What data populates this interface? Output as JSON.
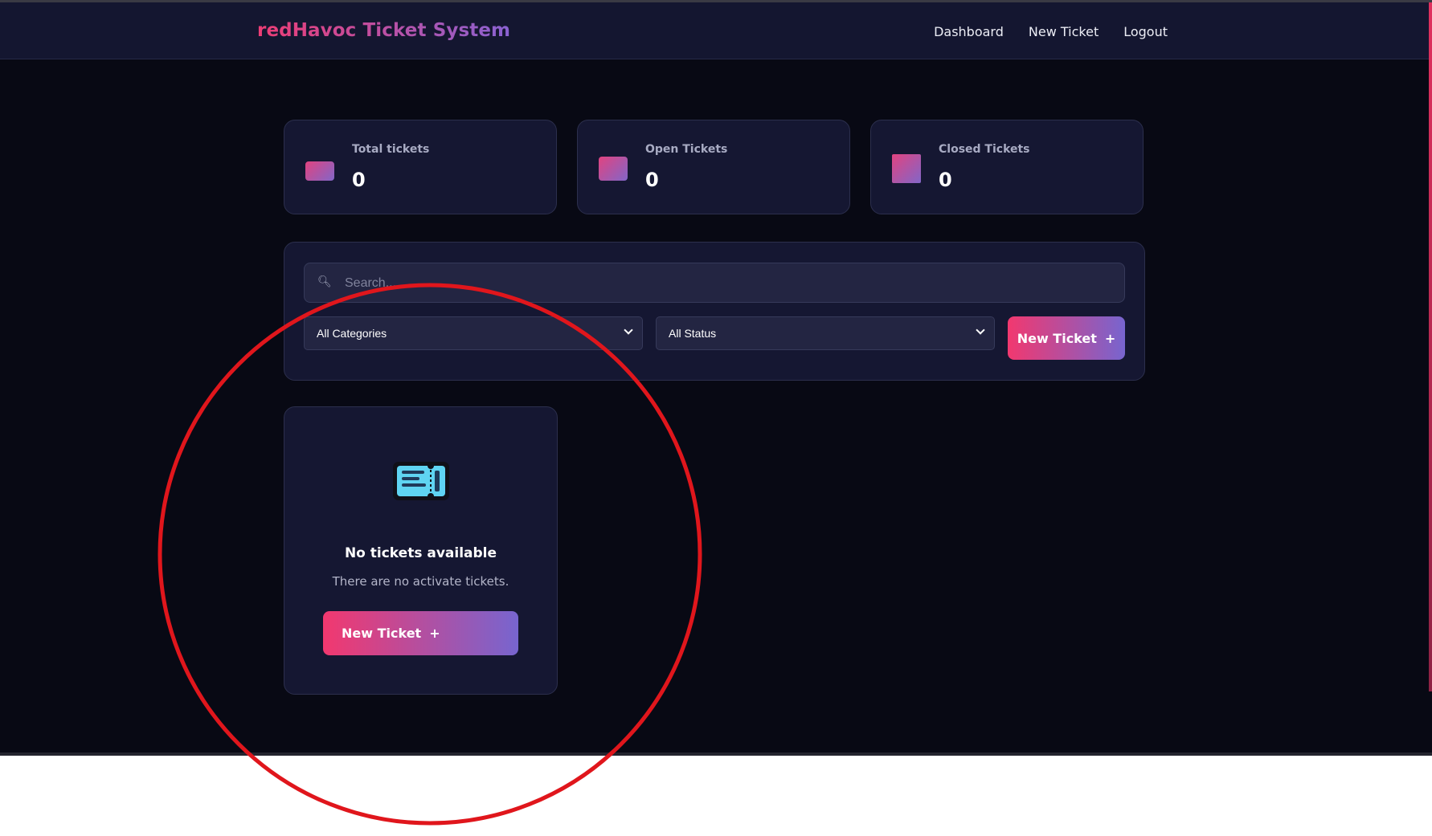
{
  "app": {
    "brand": "redHavoc Ticket System",
    "nav": [
      "Dashboard",
      "New Ticket",
      "Logout"
    ]
  },
  "stats": [
    {
      "label": "Total tickets",
      "value": "0",
      "icon": "tickets-icon"
    },
    {
      "label": "Open Tickets",
      "value": "0",
      "icon": "open-book-icon"
    },
    {
      "label": "Closed Tickets",
      "value": "0",
      "icon": "closed-box-icon"
    }
  ],
  "filters": {
    "search_placeholder": "Search...",
    "category_value": "All Categories",
    "status_value": "All Status",
    "new_ticket_label": "New Ticket",
    "plus": "+"
  },
  "empty_state": {
    "title": "No tickets available",
    "description": "There are no activate tickets.",
    "button_label": "New Ticket",
    "plus": "+",
    "icon": "ticket-icon"
  },
  "colors": {
    "background": "#080914",
    "card": "#151732",
    "navbar": "#141630",
    "accent_start": "#f2386f",
    "accent_end": "#7765cf",
    "annotation": "#e0161c"
  }
}
